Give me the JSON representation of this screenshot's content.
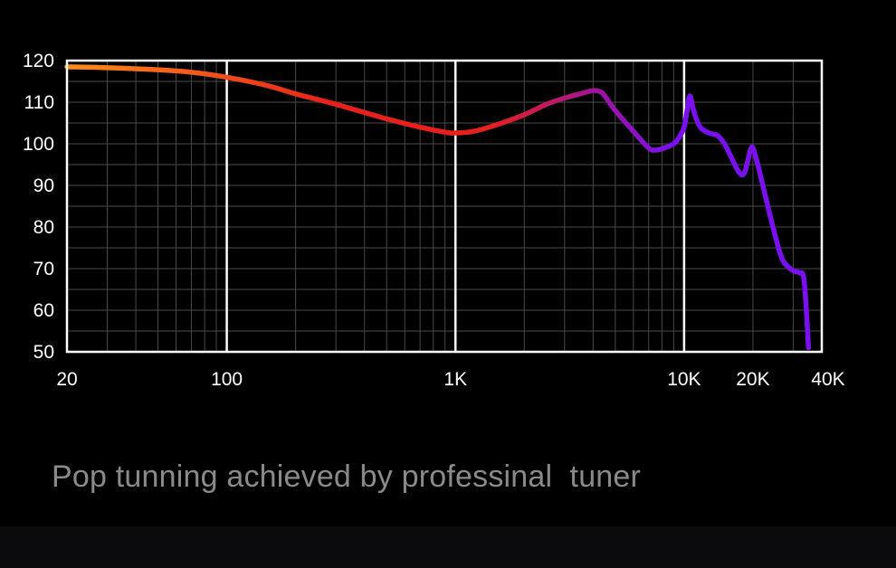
{
  "caption": "Pop tunning achieved by professinal  tuner",
  "colors": {
    "background": "#000000",
    "grid_major": "#ffffff",
    "grid_minor": "#4a4a4a",
    "curve_start": "#ff8c1a",
    "curve_mid": "#e8201a",
    "curve_peak": "#a0149a",
    "curve_end": "#7a10f0",
    "caption": "#8a8a8a"
  },
  "chart_data": {
    "type": "line",
    "title": "",
    "xlabel": "",
    "ylabel": "",
    "xscale": "log",
    "xlim": [
      20,
      40000
    ],
    "ylim": [
      50,
      120
    ],
    "grid": true,
    "y_ticks": [
      {
        "value": 120,
        "label": "120"
      },
      {
        "value": 110,
        "label": "110"
      },
      {
        "value": 100,
        "label": "100"
      },
      {
        "value": 90,
        "label": "90"
      },
      {
        "value": 80,
        "label": "80"
      },
      {
        "value": 70,
        "label": "70"
      },
      {
        "value": 60,
        "label": "60"
      },
      {
        "value": 50,
        "label": "50"
      }
    ],
    "x_ticks": [
      {
        "value": 20,
        "label": "20"
      },
      {
        "value": 100,
        "label": "100"
      },
      {
        "value": 1000,
        "label": "1K"
      },
      {
        "value": 10000,
        "label": "10K"
      },
      {
        "value": 20000,
        "label": "20K"
      },
      {
        "value": 40000,
        "label": "40K"
      }
    ],
    "series": [
      {
        "name": "",
        "x": [
          20,
          30,
          50,
          70,
          100,
          150,
          200,
          300,
          500,
          700,
          900,
          1000,
          1200,
          1500,
          2000,
          2500,
          3000,
          3500,
          4000,
          4300,
          4500,
          5000,
          6000,
          7000,
          7500,
          8000,
          9000,
          9500,
          10000,
          10300,
          10600,
          11000,
          11500,
          12000,
          13000,
          14000,
          15000,
          16000,
          17000,
          17500,
          18000,
          18500,
          19000,
          19500,
          20000,
          21000,
          23000,
          25000,
          27000,
          30000,
          32000,
          33500,
          35000
        ],
        "y": [
          118.5,
          118.3,
          117.8,
          117.2,
          116,
          114,
          112,
          109.5,
          106,
          104,
          102.8,
          102.6,
          103,
          104.5,
          107,
          109.5,
          111,
          112,
          112.8,
          112.5,
          111.5,
          108,
          103,
          99,
          98.5,
          98.8,
          100,
          101.5,
          104,
          108,
          111.5,
          108,
          105,
          103.5,
          102.5,
          102,
          100,
          97,
          94,
          93,
          92.5,
          93.5,
          96,
          98.5,
          99,
          95,
          86,
          78,
          72,
          69.5,
          69,
          67,
          51
        ]
      }
    ]
  }
}
